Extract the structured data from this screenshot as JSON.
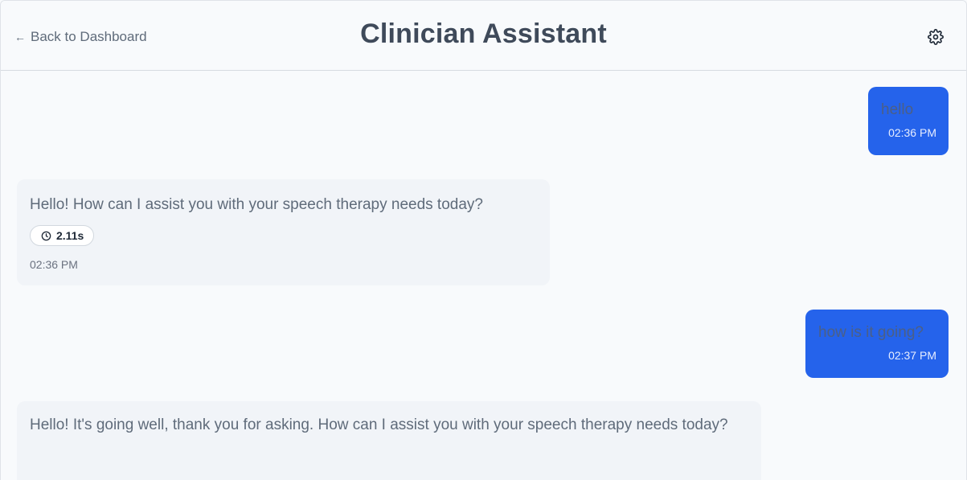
{
  "header": {
    "back_label": "Back to Dashboard",
    "title": "Clinician Assistant",
    "back_icon": "arrow-left-icon",
    "settings_icon": "gear-icon"
  },
  "messages": [
    {
      "role": "user",
      "text": "hello",
      "time": "02:36 PM"
    },
    {
      "role": "assistant",
      "text": "Hello! How can I assist you with your speech therapy needs today?",
      "latency": "2.11s",
      "latency_icon": "clock-icon",
      "time": "02:36 PM"
    },
    {
      "role": "user",
      "text": "how is it going?",
      "time": "02:37 PM"
    },
    {
      "role": "assistant",
      "text": "Hello! It's going well, thank you for asking. How can I assist you with your speech therapy needs today?"
    }
  ],
  "colors": {
    "user_bubble": "#2563eb",
    "assistant_bubble": "#f1f4f8",
    "background": "#f8fafc",
    "title": "#3f4a5a"
  }
}
